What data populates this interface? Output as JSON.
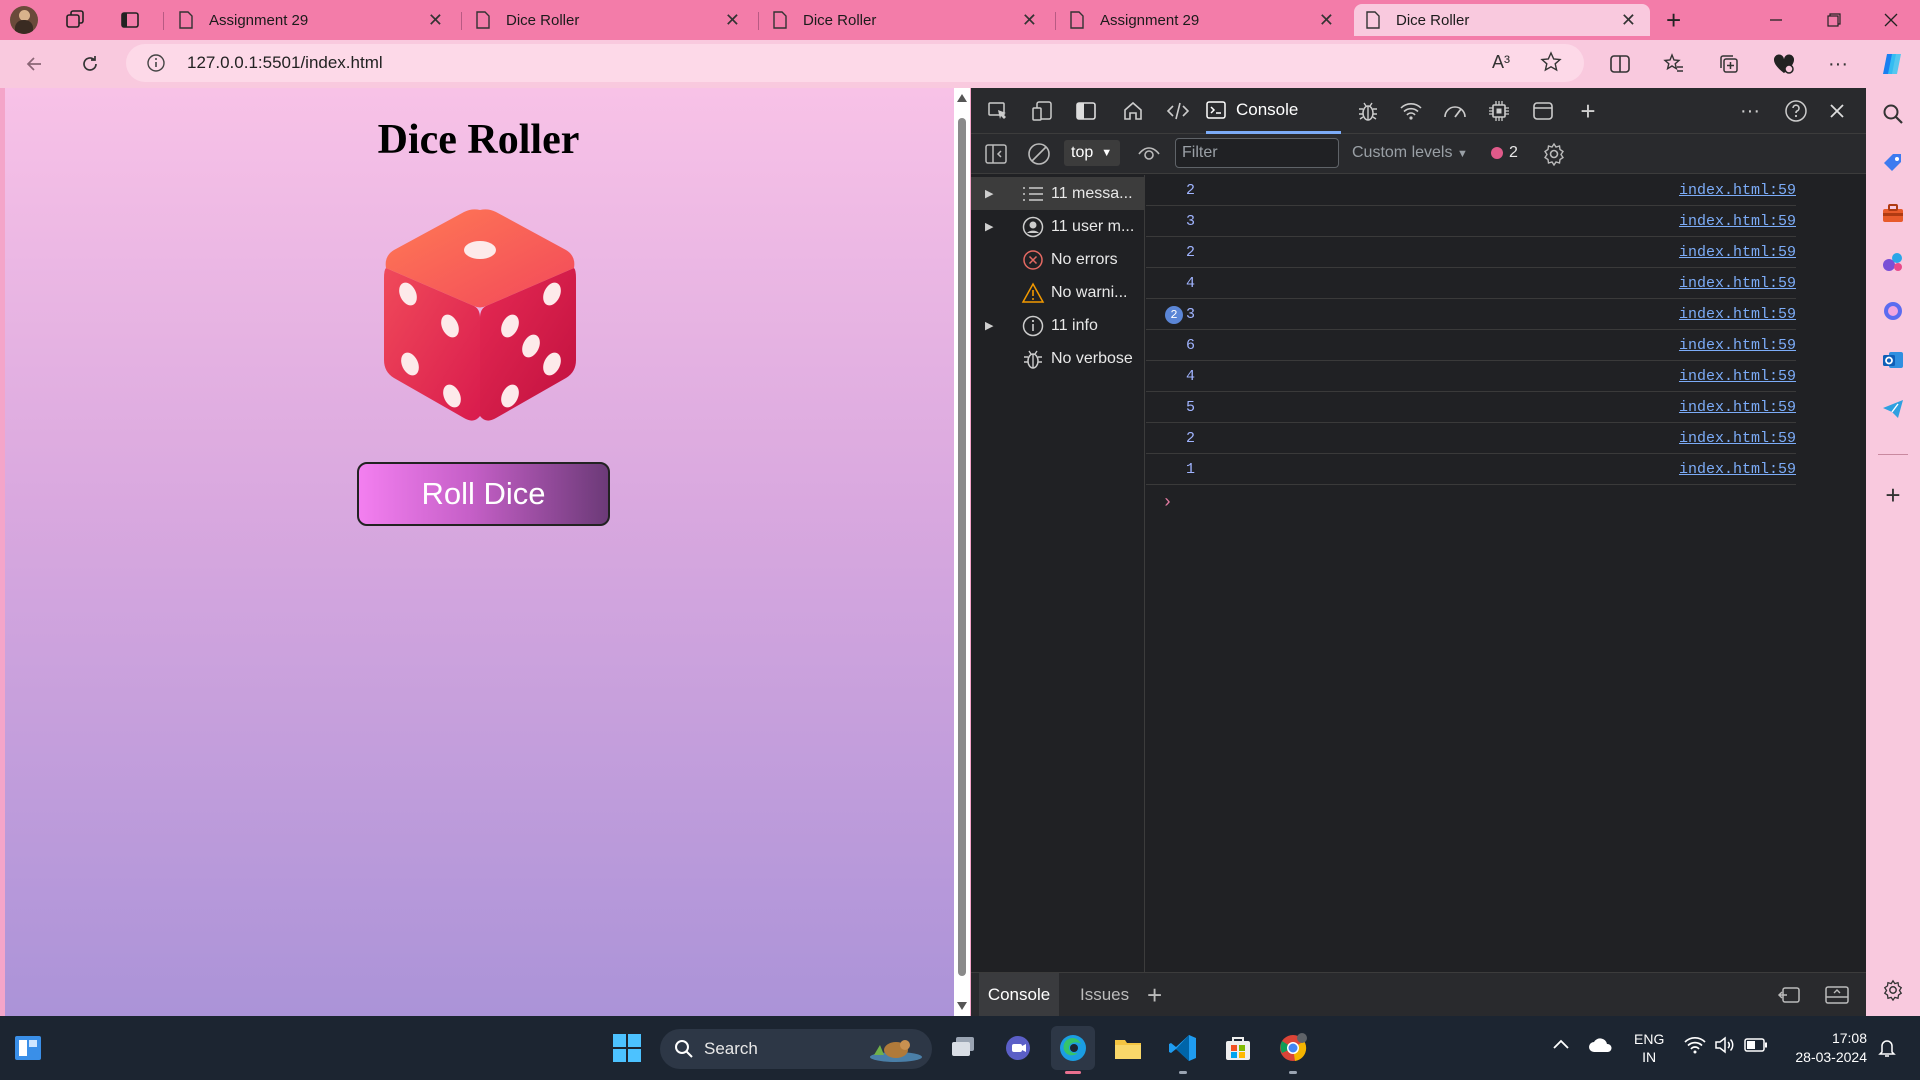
{
  "browser": {
    "tabs": [
      {
        "label": "Assignment 29",
        "active": false
      },
      {
        "label": "Dice Roller",
        "active": false
      },
      {
        "label": "Dice Roller",
        "active": false
      },
      {
        "label": "Assignment 29",
        "active": false
      },
      {
        "label": "Dice Roller",
        "active": true
      }
    ],
    "url": "127.0.0.1:5501/index.html",
    "read_aloud_label": "A³",
    "accent": "#f37ca9"
  },
  "page": {
    "title": "Dice Roller",
    "button_label": "Roll Dice",
    "dice_icon": "dice-icon"
  },
  "devtools": {
    "console_tab_label": "Console",
    "context": "top",
    "filter_placeholder": "Filter",
    "custom_levels": "Custom levels",
    "message_count": "2",
    "sidebar": [
      {
        "label": "11 messa...",
        "icon": "list-icon",
        "expandable": true
      },
      {
        "label": "11 user m...",
        "icon": "user-icon",
        "expandable": true
      },
      {
        "label": "No errors",
        "icon": "error-icon",
        "expandable": false
      },
      {
        "label": "No warni...",
        "icon": "warning-icon",
        "expandable": false
      },
      {
        "label": "11 info",
        "icon": "info-icon",
        "expandable": true
      },
      {
        "label": "No verbose",
        "icon": "bug-icon",
        "expandable": false
      }
    ],
    "log": [
      {
        "value": "2",
        "source": "index.html:59",
        "repeat": ""
      },
      {
        "value": "3",
        "source": "index.html:59",
        "repeat": ""
      },
      {
        "value": "2",
        "source": "index.html:59",
        "repeat": ""
      },
      {
        "value": "4",
        "source": "index.html:59",
        "repeat": ""
      },
      {
        "value": "3",
        "source": "index.html:59",
        "repeat": "2"
      },
      {
        "value": "6",
        "source": "index.html:59",
        "repeat": ""
      },
      {
        "value": "4",
        "source": "index.html:59",
        "repeat": ""
      },
      {
        "value": "5",
        "source": "index.html:59",
        "repeat": ""
      },
      {
        "value": "2",
        "source": "index.html:59",
        "repeat": ""
      },
      {
        "value": "1",
        "source": "index.html:59",
        "repeat": ""
      }
    ],
    "drawer_tabs": {
      "console": "Console",
      "issues": "Issues"
    }
  },
  "taskbar": {
    "search_label": "Search",
    "language": "ENG",
    "region": "IN",
    "time": "17:08",
    "date": "28-03-2024"
  }
}
